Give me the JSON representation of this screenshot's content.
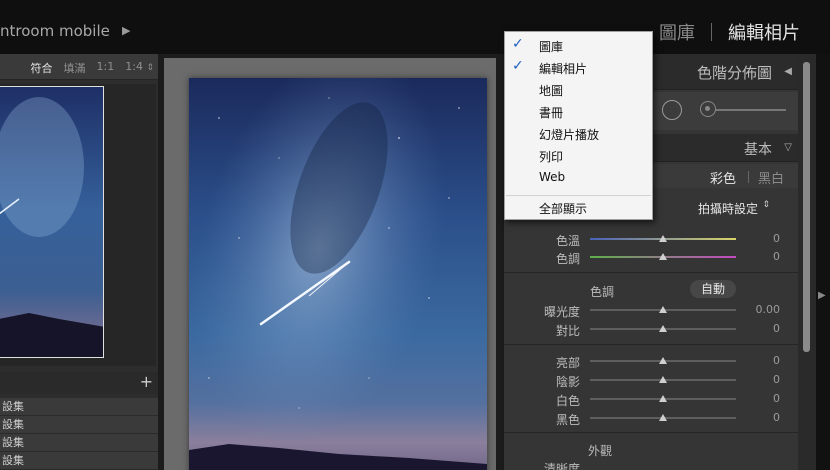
{
  "topbar": {
    "app_title": "ntroom mobile",
    "modules": [
      {
        "label": "圖庫",
        "active": false
      },
      {
        "label": "編輯相片",
        "active": true
      }
    ]
  },
  "navigator": {
    "zoom_options": [
      "符合",
      "填滿",
      "1:1",
      "1:4"
    ],
    "selected_zoom": "符合"
  },
  "left": {
    "presets": [
      "設集",
      "設集",
      "設集",
      "設集"
    ]
  },
  "right": {
    "histogram_title": "色階分佈圖",
    "basic_title": "基本",
    "treatment_color": "彩色",
    "treatment_bw": "黑白",
    "wb_value": "拍攝時設定",
    "wb_sliders": [
      {
        "label": "色溫",
        "value": "0",
        "level": 0.5
      },
      {
        "label": "色調",
        "value": "0",
        "level": 0.5
      }
    ],
    "tone_label": "色調",
    "auto_label": "自動",
    "tone_sliders": [
      {
        "label": "曝光度",
        "value": "0.00",
        "level": 0.5
      },
      {
        "label": "對比",
        "value": "0",
        "level": 0.5
      }
    ],
    "tone2_sliders": [
      {
        "label": "亮部",
        "value": "0",
        "level": 0.5
      },
      {
        "label": "陰影",
        "value": "0",
        "level": 0.5
      },
      {
        "label": "白色",
        "value": "0",
        "level": 0.5
      },
      {
        "label": "黑色",
        "value": "0",
        "level": 0.5
      }
    ],
    "presence_label": "外觀",
    "clarity_label": "清晰度"
  },
  "menu": {
    "items": [
      {
        "label": "圖庫",
        "checked": true
      },
      {
        "label": "編輯相片",
        "checked": true
      },
      {
        "label": "地圖",
        "checked": false
      },
      {
        "label": "書冊",
        "checked": false
      },
      {
        "label": "幻燈片播放",
        "checked": false
      },
      {
        "label": "列印",
        "checked": false
      },
      {
        "label": "Web",
        "checked": false
      }
    ],
    "show_all": "全部顯示"
  },
  "colors": {
    "accent_check": "#1f5fbf",
    "panel_bg": "#353535"
  }
}
